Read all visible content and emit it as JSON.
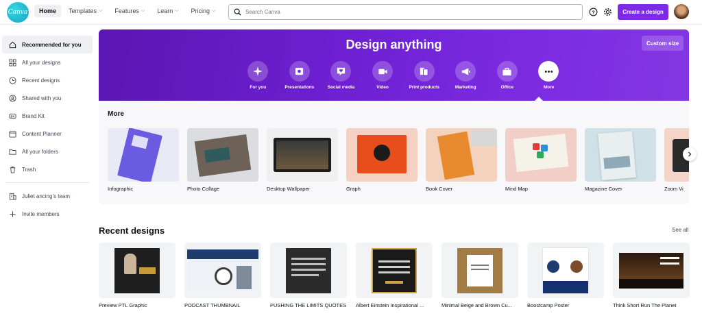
{
  "topbar": {
    "logo_text": "Canva",
    "nav": [
      {
        "label": "Home",
        "active": true,
        "dropdown": false
      },
      {
        "label": "Templates",
        "active": false,
        "dropdown": true
      },
      {
        "label": "Features",
        "active": false,
        "dropdown": true
      },
      {
        "label": "Learn",
        "active": false,
        "dropdown": true
      },
      {
        "label": "Pricing",
        "active": false,
        "dropdown": true
      }
    ],
    "search_placeholder": "Search Canva",
    "help_icon": "question-circle-icon",
    "settings_icon": "gear-icon",
    "create_label": "Create a design",
    "accent_color": "#7d2ae8"
  },
  "sidebar": {
    "items": [
      {
        "label": "Recommended for you",
        "icon": "home-icon",
        "active": true
      },
      {
        "label": "All your designs",
        "icon": "grid-icon",
        "active": false
      },
      {
        "label": "Recent designs",
        "icon": "clock-icon",
        "active": false
      },
      {
        "label": "Shared with you",
        "icon": "people-icon",
        "active": false
      },
      {
        "label": "Brand Kit",
        "icon": "brand-kit-icon",
        "active": false
      },
      {
        "label": "Content Planner",
        "icon": "calendar-icon",
        "active": false
      },
      {
        "label": "All your folders",
        "icon": "folder-icon",
        "active": false
      },
      {
        "label": "Trash",
        "icon": "trash-icon",
        "active": false
      }
    ],
    "team_label": "Juliet ancing's team",
    "invite_label": "Invite members"
  },
  "hero": {
    "title": "Design anything",
    "custom_size_label": "Custom size",
    "categories": [
      {
        "label": "For you",
        "icon": "sparkle-icon",
        "active": false
      },
      {
        "label": "Presentations",
        "icon": "presentation-icon",
        "active": false
      },
      {
        "label": "Social media",
        "icon": "heart-chat-icon",
        "active": false
      },
      {
        "label": "Video",
        "icon": "video-camera-icon",
        "active": false
      },
      {
        "label": "Print products",
        "icon": "print-icon",
        "active": false
      },
      {
        "label": "Marketing",
        "icon": "megaphone-icon",
        "active": false
      },
      {
        "label": "Office",
        "icon": "briefcase-icon",
        "active": false
      },
      {
        "label": "More",
        "icon": "more-dots-icon",
        "active": true
      }
    ]
  },
  "more": {
    "title": "More",
    "items": [
      {
        "label": "Infographic",
        "bg": "#e8eaf6"
      },
      {
        "label": "Photo Collage",
        "bg": "#dadcdf"
      },
      {
        "label": "Desktop Wallpaper",
        "bg": "#efefef"
      },
      {
        "label": "Graph",
        "bg": "#f5d1c4"
      },
      {
        "label": "Book Cover",
        "bg": "#f3d3be"
      },
      {
        "label": "Mind Map",
        "bg": "#f1cfc7"
      },
      {
        "label": "Magazine Cover",
        "bg": "#cfe0e6"
      },
      {
        "label": "Zoom Vi",
        "bg": "#f4d4c8"
      }
    ]
  },
  "recent": {
    "title": "Recent designs",
    "see_all": "See all",
    "items": [
      {
        "label": "Preview PTL Graphic"
      },
      {
        "label": "PODCAST THUMBNAIL"
      },
      {
        "label": "PUSHING THE LIMITS QUOTES"
      },
      {
        "label": "Albert Einstein Inspirational ..."
      },
      {
        "label": "Minimal Beige and Brown Cu..."
      },
      {
        "label": "Boostcamp Poster"
      },
      {
        "label": "Think Short Run The Planet"
      }
    ]
  }
}
